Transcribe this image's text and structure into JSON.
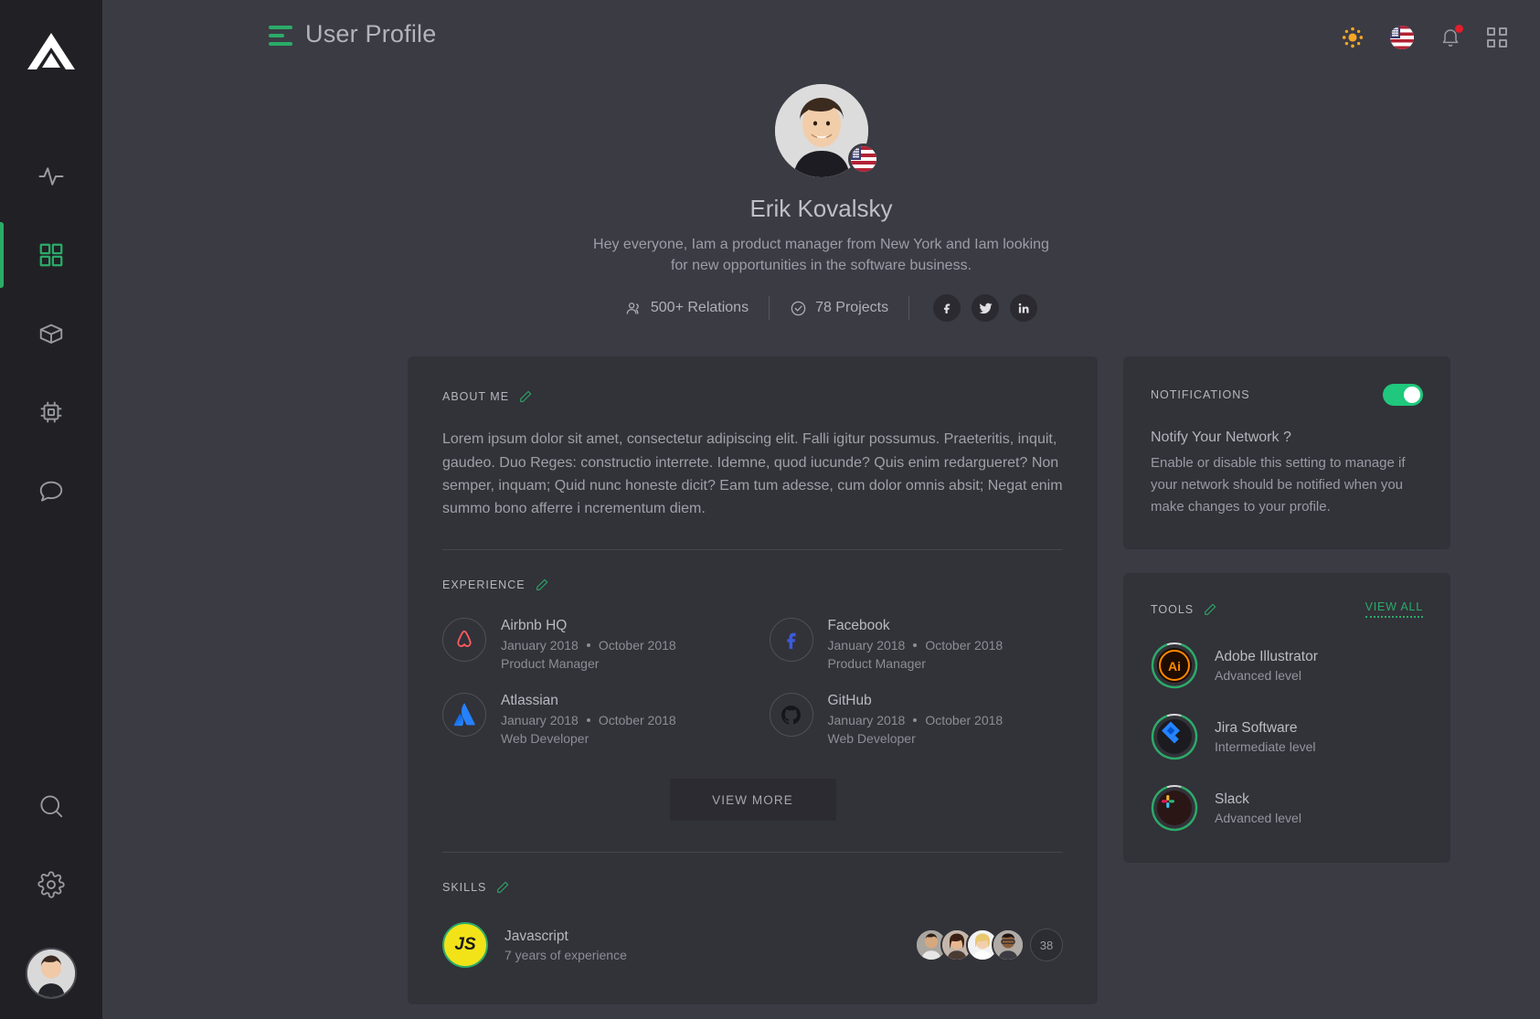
{
  "app": {
    "logo_icon": "triangle-logo",
    "accent_green": "#2bab68",
    "bg": "#3b3b44",
    "card_bg": "#323239",
    "sidebar_bg": "#212125"
  },
  "sidebar": {
    "items": [
      {
        "icon": "activity-pulse-icon",
        "name": "activity",
        "active": false
      },
      {
        "icon": "dashboard-grid-icon",
        "name": "dashboard",
        "active": true
      },
      {
        "icon": "box-cube-icon",
        "name": "packages",
        "active": false
      },
      {
        "icon": "chip-processor-icon",
        "name": "devices",
        "active": false
      },
      {
        "icon": "chat-bubble-icon",
        "name": "messages",
        "active": false
      }
    ],
    "bottom_items": [
      {
        "icon": "search-icon",
        "name": "search"
      },
      {
        "icon": "gear-icon",
        "name": "settings"
      }
    ],
    "avatar_name": "user-avatar"
  },
  "header": {
    "menu_icon": "hamburger-menu-icon",
    "title": "User Profile",
    "actions": [
      {
        "icon": "sun-icon",
        "name": "theme-toggle"
      },
      {
        "icon": "us-flag-icon",
        "name": "language-selector"
      },
      {
        "icon": "bell-icon",
        "name": "notifications",
        "has_badge": true
      },
      {
        "icon": "grid-apps-icon",
        "name": "apps-menu"
      }
    ]
  },
  "profile": {
    "name": "Erik Kovalsky",
    "bio": "Hey everyone,  Iam a product manager from New York and Iam looking for new opportunities in the software business.",
    "country_flag": "us-flag-icon",
    "stats": [
      {
        "icon": "people-icon",
        "label": "500+ Relations"
      },
      {
        "icon": "check-circle-icon",
        "label": "78 Projects"
      }
    ],
    "socials": [
      {
        "icon": "facebook-icon",
        "name": "facebook"
      },
      {
        "icon": "twitter-icon",
        "name": "twitter"
      },
      {
        "icon": "linkedin-icon",
        "name": "linkedin"
      }
    ]
  },
  "about": {
    "title": "ABOUT ME",
    "edit_icon": "pencil-edit-icon",
    "text": "Lorem ipsum dolor sit amet, consectetur adipiscing elit. Falli igitur possumus. Praeteritis, inquit, gaudeo. Duo Reges: constructio interrete. Idemne, quod iucunde? Quis enim redargueret? Non semper, inquam; Quid nunc honeste dicit? Eam tum adesse, cum dolor omnis absit; Negat enim summo bono afferre i ncrementum diem."
  },
  "experience": {
    "title": "EXPERIENCE",
    "edit_icon": "pencil-edit-icon",
    "items": [
      {
        "company": "Airbnb HQ",
        "start": "January 2018",
        "end": "October 2018",
        "role": "Product Manager",
        "logo": "airbnb-logo-icon"
      },
      {
        "company": "Facebook",
        "start": "January 2018",
        "end": "October 2018",
        "role": "Product Manager",
        "logo": "facebook-logo-icon"
      },
      {
        "company": "Atlassian",
        "start": "January 2018",
        "end": "October 2018",
        "role": "Web Developer",
        "logo": "atlassian-logo-icon"
      },
      {
        "company": "GitHub",
        "start": "January 2018",
        "end": "October 2018",
        "role": "Web Developer",
        "logo": "github-logo-icon"
      }
    ],
    "view_more_label": "VIEW MORE"
  },
  "skills": {
    "title": "SKILLS",
    "edit_icon": "pencil-edit-icon",
    "items": [
      {
        "badge": "JS",
        "name": "Javascript",
        "experience": "7 years of experience",
        "avatars": 4,
        "more_count": "38"
      }
    ]
  },
  "notifications_card": {
    "title": "NOTIFICATIONS",
    "toggle_on": true,
    "question": "Notify Your Network ?",
    "description": "Enable or disable this setting to manage if your network should be notified when you make changes to your profile."
  },
  "tools_card": {
    "title": "TOOLS",
    "edit_icon": "pencil-edit-icon",
    "view_all_label": "VIEW ALL",
    "items": [
      {
        "name": "Adobe Illustrator",
        "level": "Advanced level",
        "icon": "adobe-illustrator-icon",
        "progress": 88
      },
      {
        "name": "Jira Software",
        "level": "Intermediate level",
        "icon": "jira-icon",
        "progress": 88
      },
      {
        "name": "Slack",
        "level": "Advanced level",
        "icon": "slack-icon",
        "progress": 88
      }
    ]
  }
}
